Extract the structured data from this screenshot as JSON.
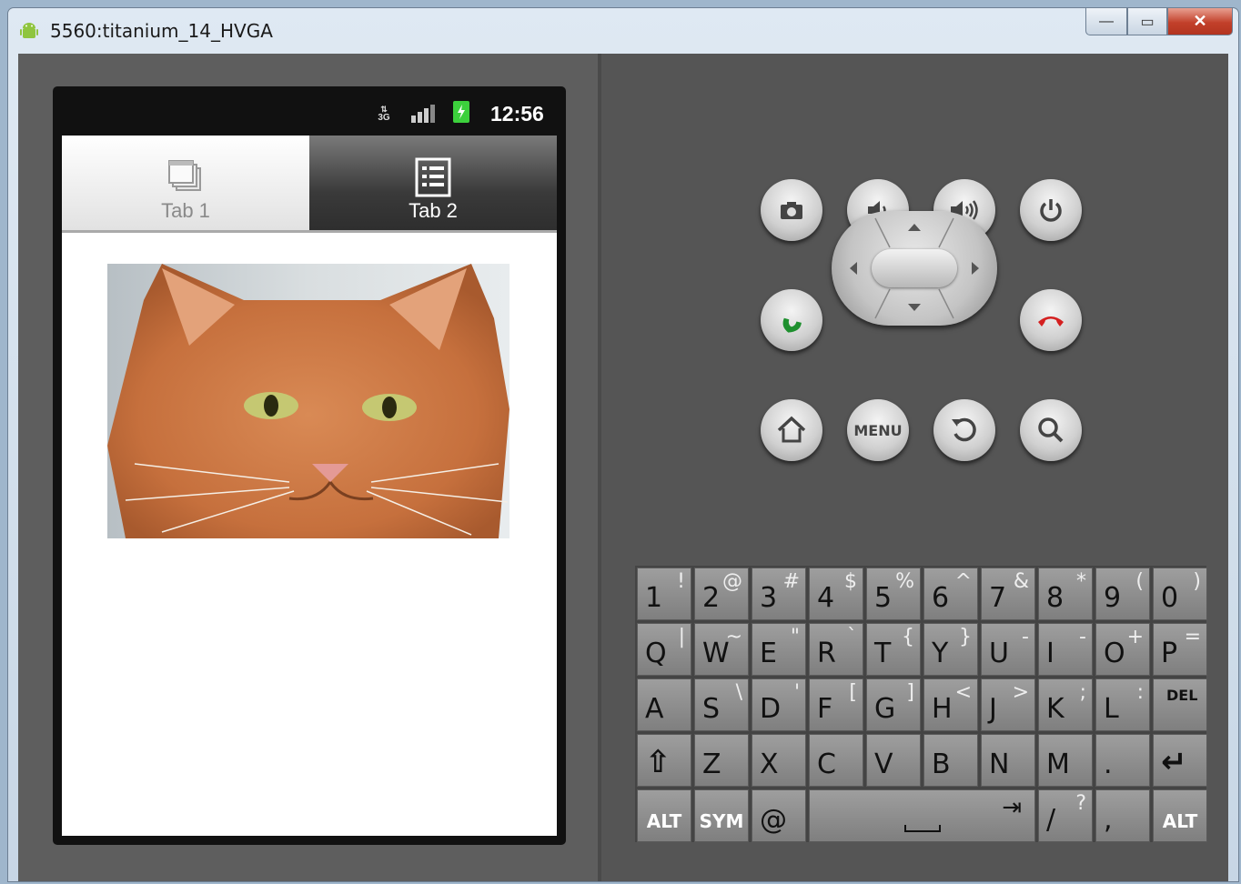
{
  "window": {
    "title": "5560:titanium_14_HVGA",
    "controls": {
      "minimize": "—",
      "maximize": "▭",
      "close": "✕"
    }
  },
  "phone": {
    "status_bar": {
      "network": "3G",
      "time": "12:56"
    },
    "tabs": [
      {
        "label": "Tab 1",
        "selected": true
      },
      {
        "label": "Tab 2",
        "selected": false
      }
    ],
    "content": {
      "image": "cat-face-photo"
    }
  },
  "hardware_buttons": {
    "row1": [
      "camera-icon",
      "volume-down-icon",
      "volume-up-icon",
      "power-icon"
    ],
    "row2": [
      "call-icon",
      "dpad",
      "end-call-icon"
    ],
    "row3": [
      "home-icon",
      "menu",
      "back-icon",
      "search-icon"
    ],
    "menu_label": "MENU"
  },
  "keyboard": {
    "rows": [
      [
        [
          "1",
          "!"
        ],
        [
          "2",
          "@"
        ],
        [
          "3",
          "#"
        ],
        [
          "4",
          "$"
        ],
        [
          "5",
          "%"
        ],
        [
          "6",
          "^"
        ],
        [
          "7",
          "&"
        ],
        [
          "8",
          "*"
        ],
        [
          "9",
          "("
        ],
        [
          "0",
          ")"
        ]
      ],
      [
        [
          "Q",
          "|"
        ],
        [
          "W",
          "~"
        ],
        [
          "E",
          "\""
        ],
        [
          "R",
          "`"
        ],
        [
          "T",
          "{"
        ],
        [
          "Y",
          "}"
        ],
        [
          "U",
          "-"
        ],
        [
          "I",
          "-"
        ],
        [
          "O",
          "+"
        ],
        [
          "P",
          "="
        ]
      ],
      [
        [
          "A",
          ""
        ],
        [
          "S",
          "\\"
        ],
        [
          "D",
          "'"
        ],
        [
          "F",
          "["
        ],
        [
          "G",
          "]"
        ],
        [
          "H",
          "<"
        ],
        [
          "J",
          ">"
        ],
        [
          "K",
          ";"
        ],
        [
          "L",
          ":"
        ],
        [
          "DEL",
          ""
        ]
      ],
      [
        [
          "⇧",
          ""
        ],
        [
          "Z",
          ""
        ],
        [
          "X",
          ""
        ],
        [
          "C",
          ""
        ],
        [
          "V",
          ""
        ],
        [
          "B",
          ""
        ],
        [
          "N",
          ""
        ],
        [
          "M",
          ""
        ],
        [
          ".",
          ""
        ],
        [
          "↵",
          ""
        ]
      ]
    ],
    "bottom": {
      "alt_left": "ALT",
      "sym": "SYM",
      "at": "@",
      "tab": "⇥",
      "slash": "/",
      "slash_alt": "?",
      "comma": ",",
      "alt_right": "ALT"
    },
    "del_label": "DEL"
  },
  "colors": {
    "emulator_bg": "#555555",
    "close_button": "#c2402a",
    "call_green": "#1e8f2e",
    "endcall_red": "#d42020"
  }
}
